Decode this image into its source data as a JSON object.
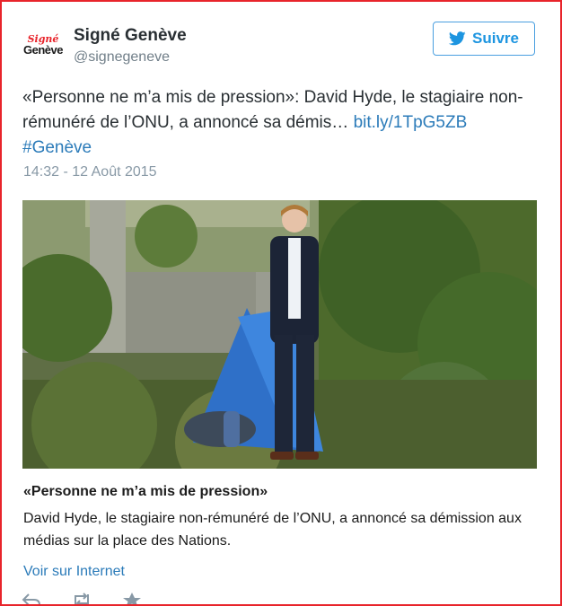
{
  "account": {
    "avatar_line1": "Signé",
    "avatar_line2": "Genève",
    "name": "Signé Genève",
    "handle": "@signegeneve"
  },
  "follow_button": {
    "label": "Suivre"
  },
  "tweet": {
    "text": "«Personne ne m’a mis de pression»: David Hyde, le stagiaire non-rémunéré de l’ONU, a annoncé sa démis… ",
    "link": "bit.ly/1TpG5ZB",
    "hashtag": "#Genève",
    "timestamp": "14:32 - 12 Août 2015"
  },
  "card": {
    "title": "«Personne ne m’a mis de pression»",
    "description": "David Hyde, le stagiaire non-rémunéré de l’ONU, a annoncé sa démission aux médias sur la place des Nations.",
    "link_label": "Voir sur Internet"
  },
  "actions": [
    "reply-icon",
    "retweet-icon",
    "favorite-icon"
  ],
  "colors": {
    "accent": "#1d95e0",
    "link": "#2b7bb9",
    "border": "#e8242b"
  }
}
